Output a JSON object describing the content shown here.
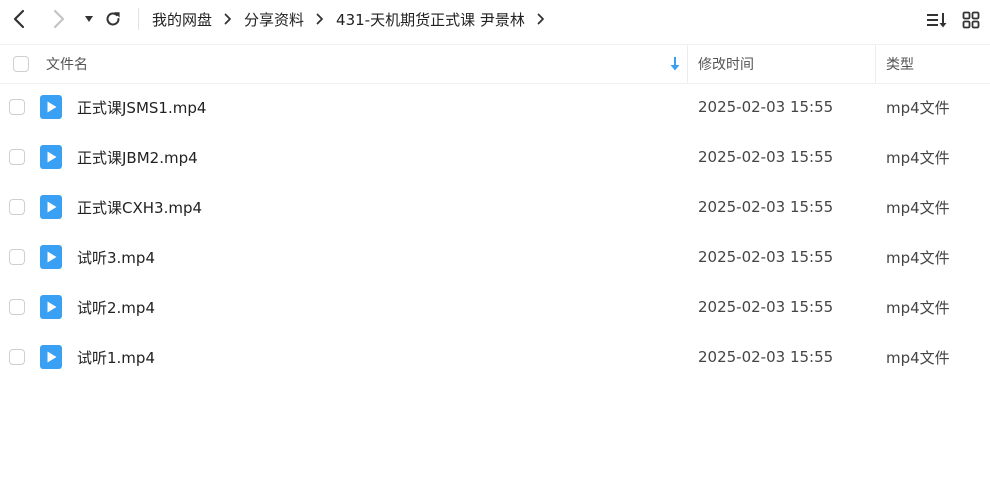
{
  "toolbar": {
    "back_icon": "chevron-left-icon",
    "forward_icon": "chevron-right-icon",
    "history_icon": "caret-down-icon",
    "refresh_icon": "refresh-icon",
    "sort_icon": "sort-list-icon",
    "grid_icon": "grid-view-icon"
  },
  "breadcrumb": {
    "items": [
      "我的网盘",
      "分享资料",
      "431-天机期货正式课 尹景林"
    ]
  },
  "header": {
    "name_label": "文件名",
    "time_label": "修改时间",
    "type_label": "类型"
  },
  "accent_color": "#3aa0f3",
  "files": [
    {
      "name": "正式课JSMS1.mp4",
      "time": "2025-02-03 15:55",
      "type": "mp4文件",
      "icon": "video-file-icon"
    },
    {
      "name": "正式课JBM2.mp4",
      "time": "2025-02-03 15:55",
      "type": "mp4文件",
      "icon": "video-file-icon"
    },
    {
      "name": "正式课CXH3.mp4",
      "time": "2025-02-03 15:55",
      "type": "mp4文件",
      "icon": "video-file-icon"
    },
    {
      "name": "试听3.mp4",
      "time": "2025-02-03 15:55",
      "type": "mp4文件",
      "icon": "video-file-icon"
    },
    {
      "name": "试听2.mp4",
      "time": "2025-02-03 15:55",
      "type": "mp4文件",
      "icon": "video-file-icon"
    },
    {
      "name": "试听1.mp4",
      "time": "2025-02-03 15:55",
      "type": "mp4文件",
      "icon": "video-file-icon"
    }
  ]
}
